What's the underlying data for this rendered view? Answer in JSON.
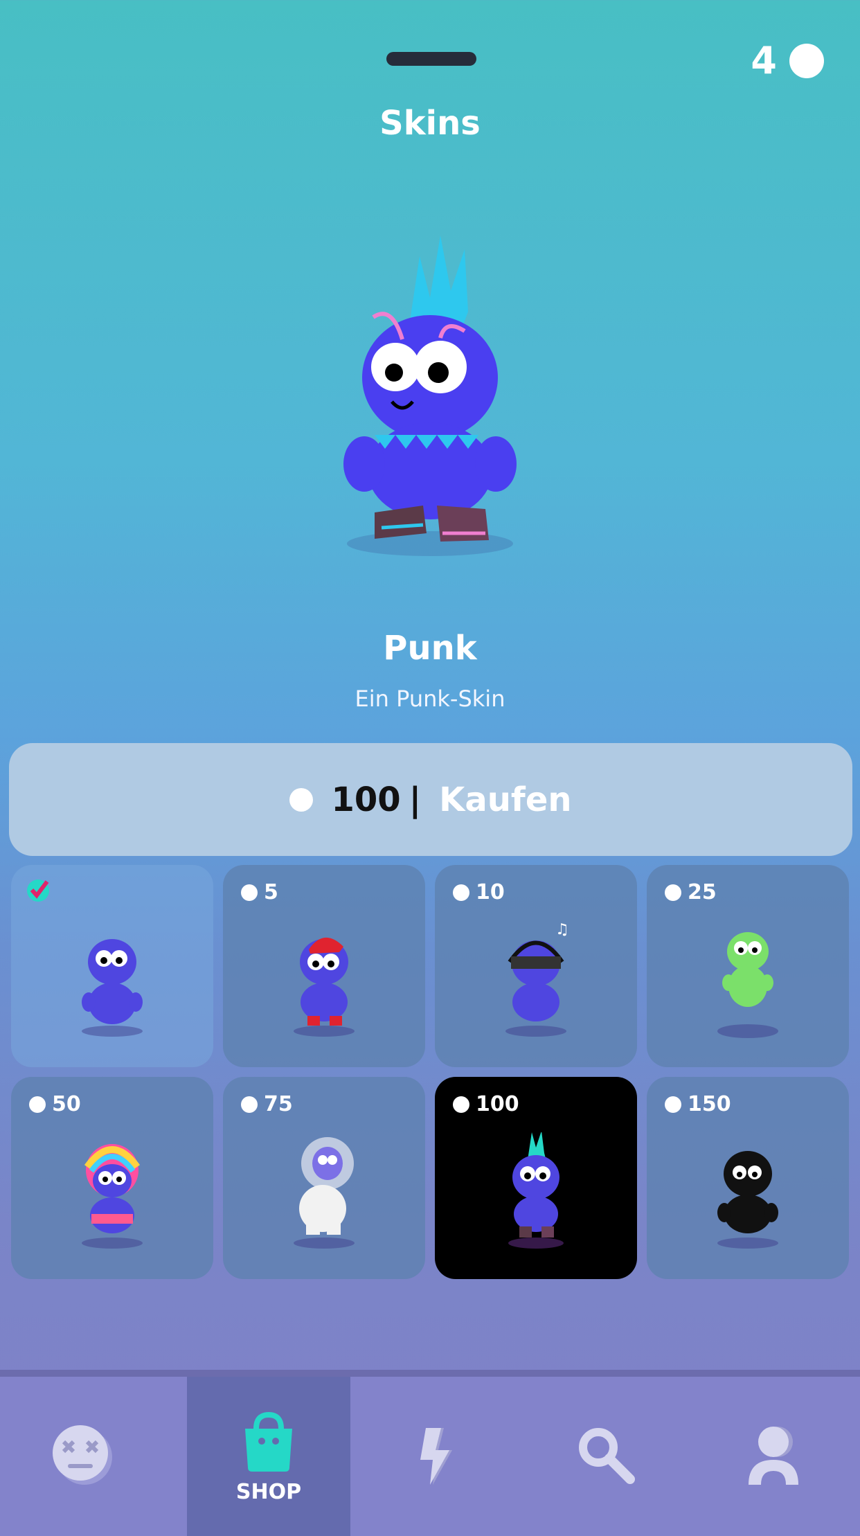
{
  "header": {
    "grabber": "drag-handle",
    "coins": "4",
    "title": "Skins"
  },
  "featured": {
    "name": "Punk",
    "description": "Ein Punk-Skin"
  },
  "buy": {
    "price": "100",
    "separator": "|",
    "label": "Kaufen"
  },
  "skins": [
    {
      "price": "",
      "owned": true,
      "body": "#4f46e0",
      "accent": "none"
    },
    {
      "price": "5",
      "owned": false,
      "body": "#4f46e0",
      "accent": "#e0232f"
    },
    {
      "price": "10",
      "owned": false,
      "body": "#4f46e0",
      "accent": "#222222"
    },
    {
      "price": "25",
      "owned": false,
      "body": "#7be06a",
      "accent": "none"
    },
    {
      "price": "50",
      "owned": false,
      "body": "#4f46e0",
      "accent": "#ff4fa0"
    },
    {
      "price": "75",
      "owned": false,
      "body": "#f2f2f2",
      "accent": "#cfd7e8"
    },
    {
      "price": "100",
      "owned": false,
      "body": "#4f46e0",
      "accent": "#25d8c7",
      "selected": true
    },
    {
      "price": "150",
      "owned": false,
      "body": "#111111",
      "accent": "none"
    }
  ],
  "nav": [
    {
      "label": "",
      "icon": "dead-face-icon"
    },
    {
      "label": "SHOP",
      "icon": "shopping-bag-icon",
      "active": true
    },
    {
      "label": "",
      "icon": "lightning-icon"
    },
    {
      "label": "",
      "icon": "search-icon"
    },
    {
      "label": "",
      "icon": "profile-icon"
    }
  ],
  "colors": {
    "accent": "#25d8c7",
    "check": "#e0256b",
    "buy_bg": "#b0cae3"
  }
}
